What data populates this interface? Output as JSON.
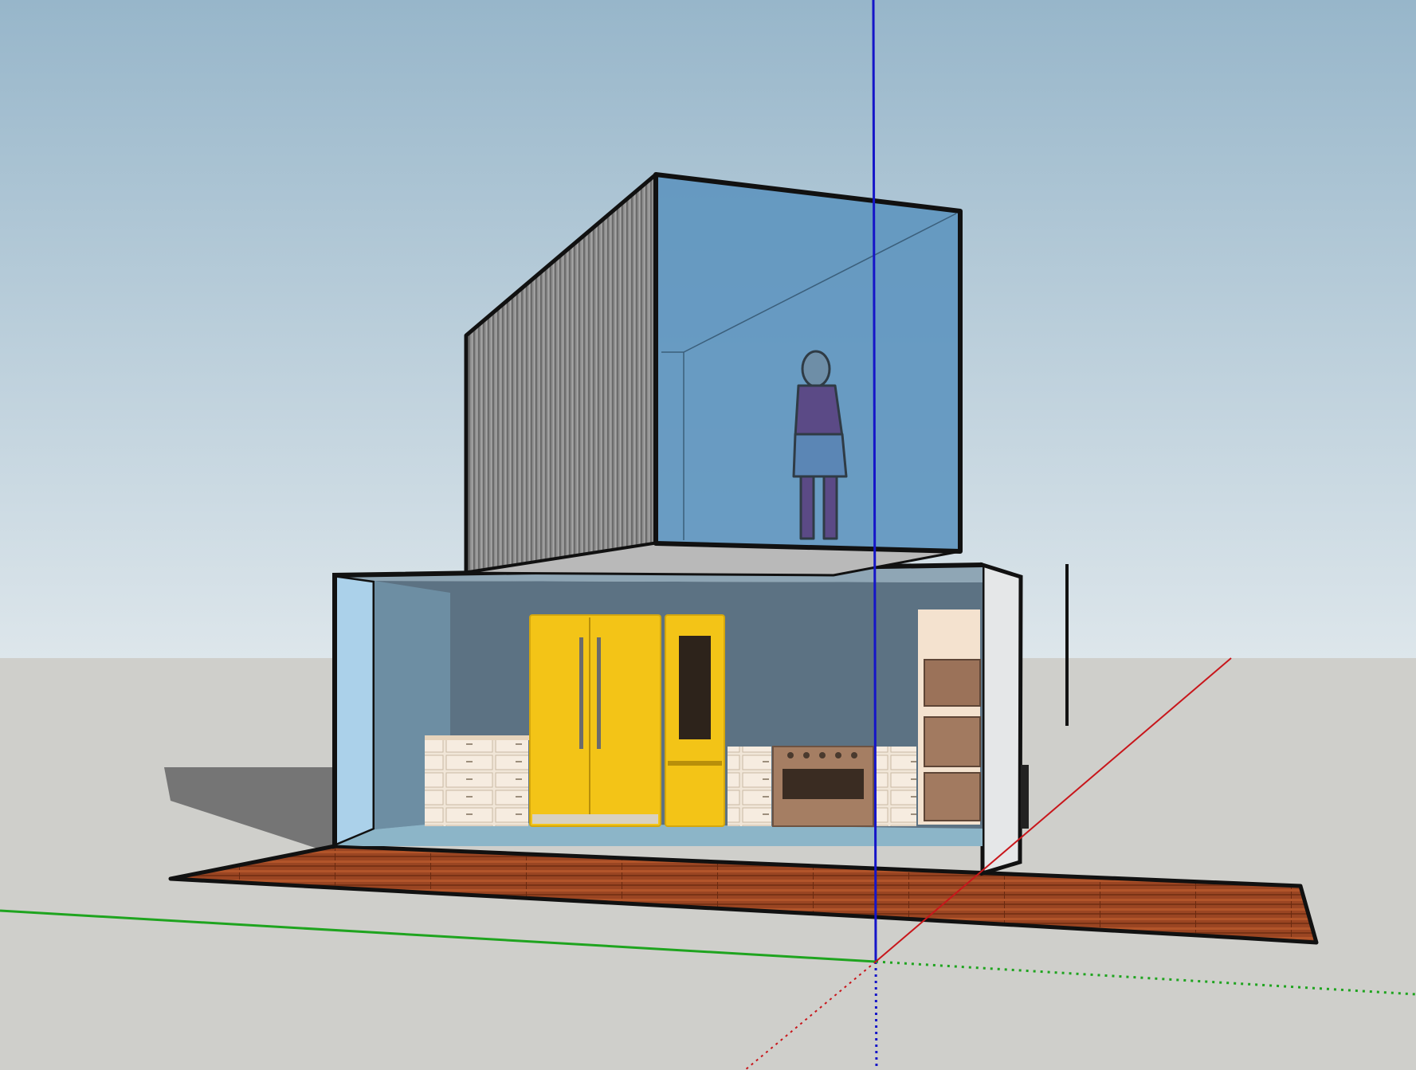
{
  "app": {
    "type": "3D modeling viewport",
    "colors": {
      "sky_top": "#97b6ca",
      "sky_bottom": "#dde6eb",
      "ground": "#cfcfcb",
      "axis_red": "#c8161b",
      "axis_green": "#1fa41f",
      "axis_blue": "#1515c8",
      "glass": "#5e95bf",
      "cladding": "#8e8e8e",
      "appliance_yellow": "#f3c417",
      "deck_wood": "#9a4522",
      "interior_wall": "#5c7283"
    }
  },
  "scene": {
    "upper_container": {
      "material": "corrugated-metal",
      "end_wall": "glass"
    },
    "lower_container": {
      "interior": "kitchen"
    },
    "deck": {
      "material": "wood-planks"
    },
    "figure": {
      "kind": "scale-figure-woman"
    },
    "appliances": [
      "refrigerator",
      "wine-fridge",
      "range",
      "wall-oven",
      "microwave"
    ],
    "axes": [
      "red-axis",
      "green-axis",
      "blue-axis"
    ]
  }
}
